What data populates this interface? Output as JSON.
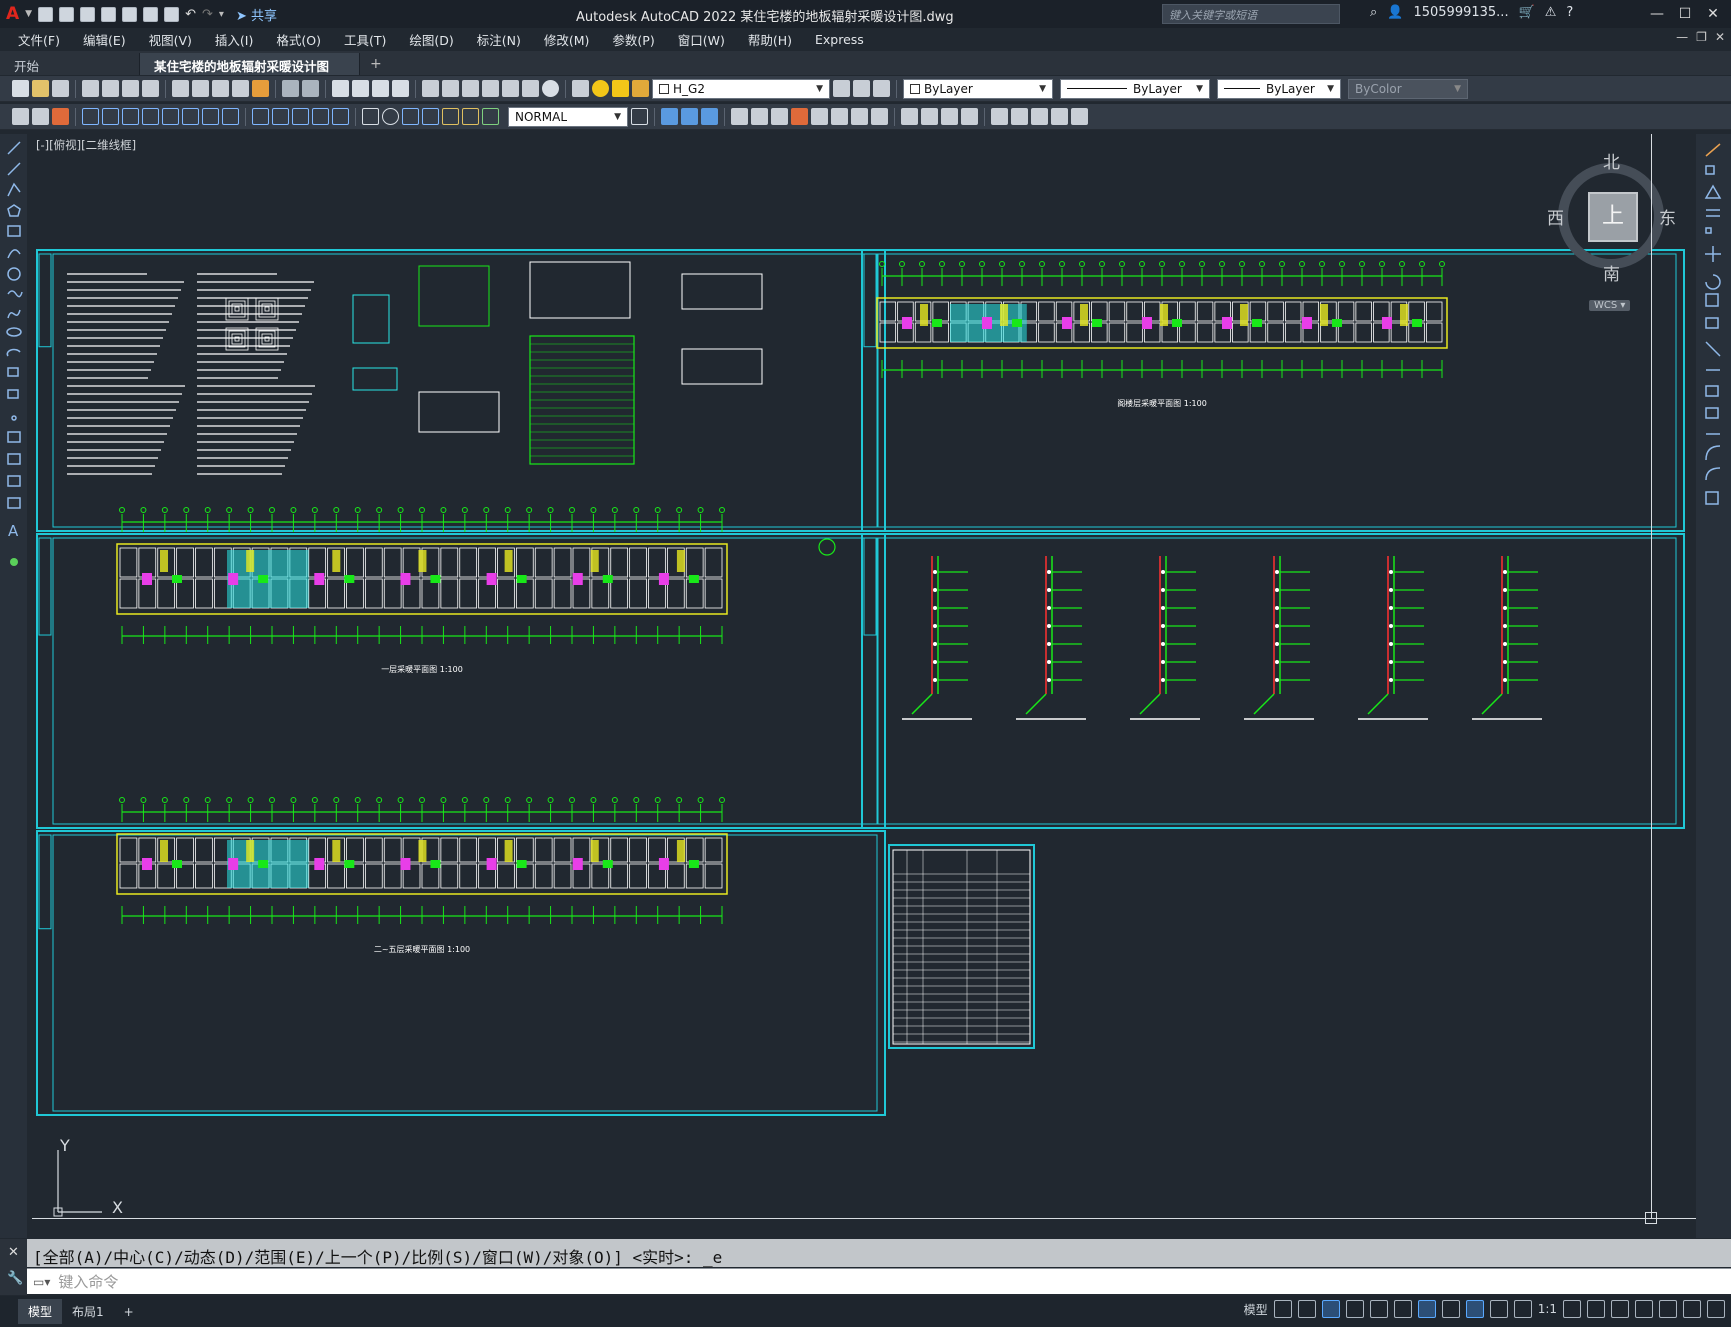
{
  "app": {
    "title": "Autodesk AutoCAD 2022    某住宅楼的地板辐射采暖设计图.dwg",
    "logo": "A",
    "share_label": "共享",
    "search_placeholder": "键入关键字或短语",
    "user": "1505999135...",
    "help": "?"
  },
  "menu": [
    "文件(F)",
    "编辑(E)",
    "视图(V)",
    "插入(I)",
    "格式(O)",
    "工具(T)",
    "绘图(D)",
    "标注(N)",
    "修改(M)",
    "参数(P)",
    "窗口(W)",
    "帮助(H)",
    "Express"
  ],
  "tabs": [
    {
      "label": "开始",
      "active": false
    },
    {
      "label": "某住宅楼的地板辐射采暖设计图*",
      "active": true
    }
  ],
  "toolbar": {
    "layer": "H_G2",
    "color": "ByLayer",
    "linetype": "ByLayer",
    "lineweight": "ByLayer",
    "plotstyle": "ByColor",
    "dimstyle": "NORMAL"
  },
  "viewport": {
    "label": "[-][俯视][二维线框]"
  },
  "viewcube": {
    "north": "北",
    "south": "南",
    "east": "东",
    "west": "西",
    "face": "上",
    "wcs": "WCS"
  },
  "drawing_titles": {
    "roof_plan": "阁楼层采暖平面图  1:100",
    "first_floor": "一层采暖平面图  1:100",
    "typical_floor": "二~五层采暖平面图  1:100"
  },
  "ucs": {
    "x": "X",
    "y": "Y"
  },
  "command": {
    "history": "[全部(A)/中心(C)/动态(D)/范围(E)/上一个(P)/比例(S)/窗口(W)/对象(O)] <实时>: _e",
    "placeholder": "键入命令"
  },
  "status": {
    "layouts": [
      "模型",
      "布局1"
    ],
    "model_label": "模型",
    "scale": "1:1"
  },
  "colors": {
    "sheet_border": "#20c8d6",
    "plan_lines": "#ffffff",
    "grid_green": "#18e818",
    "heating_cyan": "#29e6e6",
    "accent_magenta": "#e83ee8",
    "accent_yellow": "#e8e820",
    "riser_red": "#ff3030"
  }
}
